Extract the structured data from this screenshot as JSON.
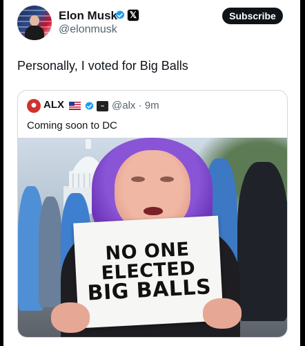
{
  "post": {
    "author": {
      "display_name": "Elon Musk",
      "handle": "@elonmusk",
      "verified_icon": "verified-badge-icon",
      "affiliate_icon": "x-logo-icon",
      "affiliate_glyph": "𝕏"
    },
    "subscribe_label": "Subscribe",
    "text": "Personally, I voted for Big Balls"
  },
  "quoted_post": {
    "author": {
      "display_name": "ALX",
      "flag_icon": "us-flag-icon",
      "handle_time": "@alx · 9m"
    },
    "text": "Coming soon to DC",
    "image": {
      "sign_lines": [
        "NO ONE",
        "ELECTED",
        "BIG BALLS"
      ]
    }
  },
  "colors": {
    "verified_blue": "#1d9bf0",
    "text_primary": "#0f1419",
    "text_secondary": "#536471",
    "border": "#cfd9de"
  }
}
